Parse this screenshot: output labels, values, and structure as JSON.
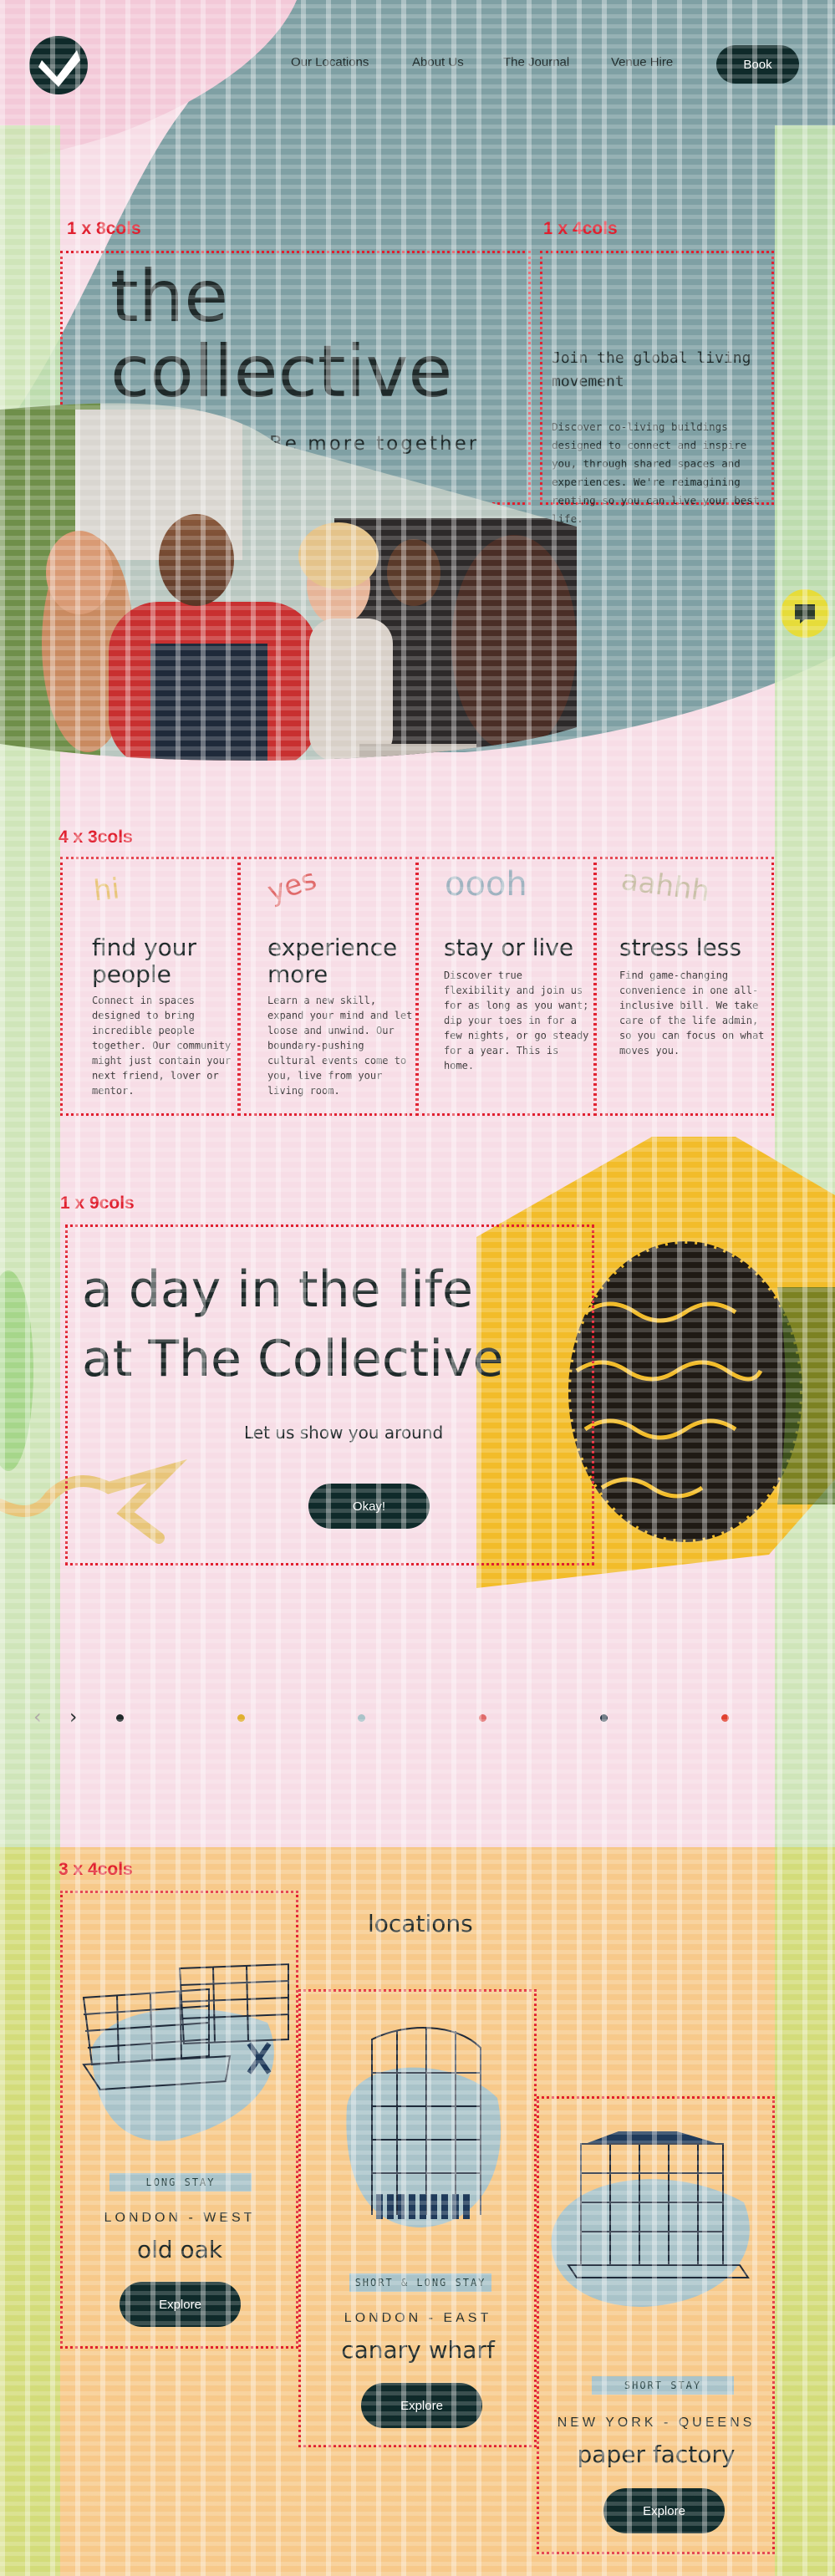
{
  "nav": {
    "links": [
      "Our Locations",
      "About Us",
      "The Journal",
      "Venue Hire"
    ],
    "book_label": "Book"
  },
  "grid_labels": {
    "hero_left": "1 x 8cols",
    "hero_right": "1 x 4cols",
    "features": "4 x 3cols",
    "day": "1 x 9cols",
    "locations": "3 x 4cols"
  },
  "hero": {
    "title_line1": "the",
    "title_line2": "collective",
    "tagline": "Be more together",
    "intro_heading": "Join the global living movement",
    "intro_body": "Discover co-living buildings designed to connect and inspire you, through shared spaces and experiences. We're reimagining renting so you can live your best life."
  },
  "features": [
    {
      "word": "hi",
      "word_color": "#e8c57a",
      "title": "find your people",
      "body": "Connect in spaces designed to bring incredible people together. Our community might just contain your next friend, lover or mentor."
    },
    {
      "word": "yes",
      "word_color": "#e06a6a",
      "title": "experience more",
      "body": "Learn a new skill, expand your mind and let loose and unwind. Our boundary-pushing cultural events come to you, live from your living room."
    },
    {
      "word": "oooh",
      "word_color": "#9fb3c0",
      "title": "stay or live",
      "body": "Discover true flexibility and join us for as long as you want; dip your toes in for a few nights, or go steady for a year. This is home."
    },
    {
      "word": "aahhh",
      "word_color": "#c9c0a8",
      "title": "stress less",
      "body": "Find game-changing convenience in one all-inclusive bill. We take care of the life admin, so you can focus on what moves you."
    }
  ],
  "day": {
    "title_line1": "a day in the life",
    "title_line2": "at The Collective",
    "subtitle": "Let us show you around",
    "button": "Okay!"
  },
  "carousel": {
    "prev": "‹",
    "next": "›",
    "dot_colors": [
      "#1f2a2a",
      "#e0b030",
      "#a9c3c9",
      "#e06a6a",
      "#2a3a4a",
      "#e0402f"
    ]
  },
  "locations": {
    "heading": "locations",
    "items": [
      {
        "badge": "LONG STAY",
        "city": "LONDON - WEST",
        "name": "old oak",
        "button": "Explore"
      },
      {
        "badge": "SHORT & LONG STAY",
        "city": "LONDON - EAST",
        "name": "canary wharf",
        "button": "Explore"
      },
      {
        "badge": "SHORT STAY",
        "city": "NEW YORK - QUEENS",
        "name": "paper factory",
        "button": "Explore"
      }
    ]
  },
  "icons": [
    "logo-mark-icon",
    "chat-icon"
  ]
}
